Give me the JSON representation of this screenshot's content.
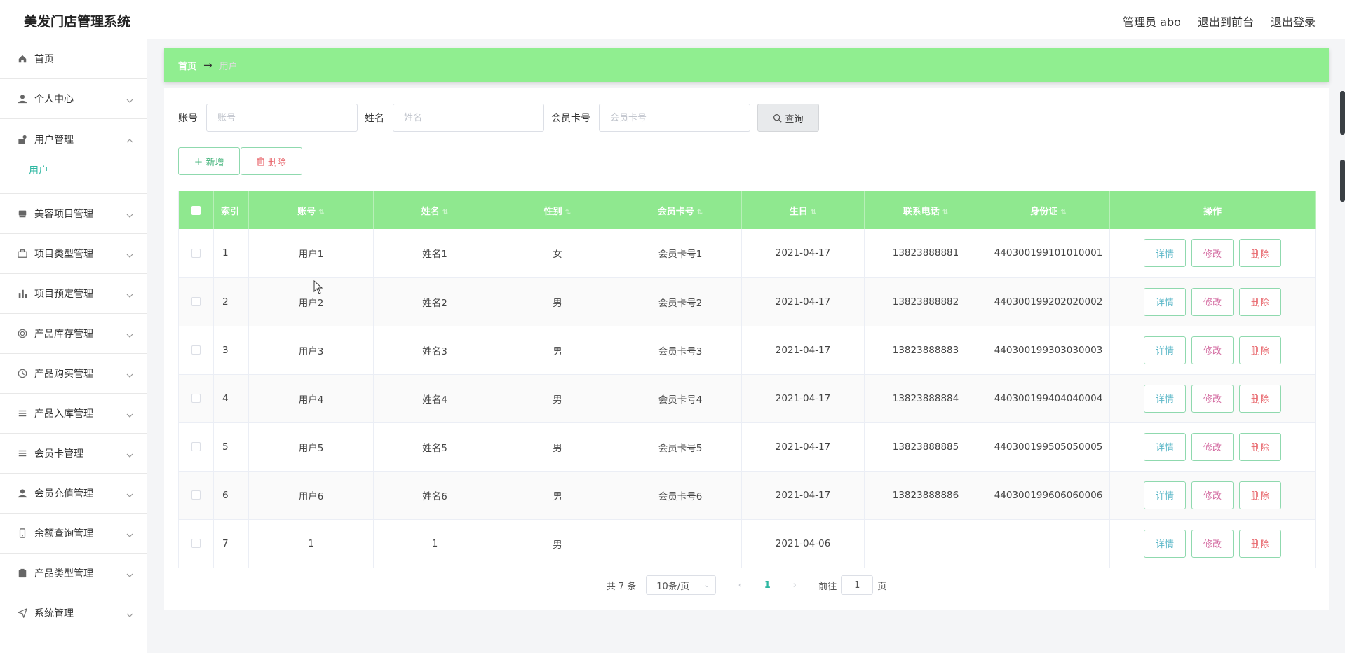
{
  "header": {
    "title": "美发门店管理系统",
    "admin": "管理员 abo",
    "to_front": "退出到前台",
    "logout": "退出登录"
  },
  "sidebar": {
    "items": [
      {
        "label": "首页",
        "icon": "home-icon"
      },
      {
        "label": "个人中心",
        "icon": "user-icon"
      },
      {
        "label": "用户管理",
        "icon": "user-manage-icon",
        "open": true,
        "children": [
          "用户"
        ]
      },
      {
        "label": "美容项目管理",
        "icon": "beauty-icon"
      },
      {
        "label": "项目类型管理",
        "icon": "briefcase-icon"
      },
      {
        "label": "项目预定管理",
        "icon": "chart-icon"
      },
      {
        "label": "产品库存管理",
        "icon": "circle-icon"
      },
      {
        "label": "产品购买管理",
        "icon": "clock-icon"
      },
      {
        "label": "产品入库管理",
        "icon": "list-icon"
      },
      {
        "label": "会员卡管理",
        "icon": "lines-icon"
      },
      {
        "label": "会员充值管理",
        "icon": "user-icon"
      },
      {
        "label": "余额查询管理",
        "icon": "phone-icon"
      },
      {
        "label": "产品类型管理",
        "icon": "clipboard-icon"
      },
      {
        "label": "系统管理",
        "icon": "send-icon"
      }
    ]
  },
  "breadcrumb": {
    "home": "首页",
    "current": "用户"
  },
  "search": {
    "account_label": "账号",
    "account_placeholder": "账号",
    "name_label": "姓名",
    "name_placeholder": "姓名",
    "card_label": "会员卡号",
    "card_placeholder": "会员卡号",
    "query_label": "查询"
  },
  "actions": {
    "add_label": "新增",
    "delete_label": "删除"
  },
  "table": {
    "headers": {
      "index": "索引",
      "account": "账号",
      "name": "姓名",
      "gender": "性别",
      "card": "会员卡号",
      "birthday": "生日",
      "phone": "联系电话",
      "id_card": "身份证",
      "ops": "操作"
    },
    "op_labels": {
      "detail": "详情",
      "edit": "修改",
      "delete": "删除"
    },
    "rows": [
      {
        "index": "1",
        "account": "用户1",
        "name": "姓名1",
        "gender": "女",
        "card": "会员卡号1",
        "birthday": "2021-04-17",
        "phone": "13823888881",
        "id_card": "440300199101010001"
      },
      {
        "index": "2",
        "account": "用户2",
        "name": "姓名2",
        "gender": "男",
        "card": "会员卡号2",
        "birthday": "2021-04-17",
        "phone": "13823888882",
        "id_card": "440300199202020002"
      },
      {
        "index": "3",
        "account": "用户3",
        "name": "姓名3",
        "gender": "男",
        "card": "会员卡号3",
        "birthday": "2021-04-17",
        "phone": "13823888883",
        "id_card": "440300199303030003"
      },
      {
        "index": "4",
        "account": "用户4",
        "name": "姓名4",
        "gender": "男",
        "card": "会员卡号4",
        "birthday": "2021-04-17",
        "phone": "13823888884",
        "id_card": "440300199404040004"
      },
      {
        "index": "5",
        "account": "用户5",
        "name": "姓名5",
        "gender": "男",
        "card": "会员卡号5",
        "birthday": "2021-04-17",
        "phone": "13823888885",
        "id_card": "440300199505050005"
      },
      {
        "index": "6",
        "account": "用户6",
        "name": "姓名6",
        "gender": "男",
        "card": "会员卡号6",
        "birthday": "2021-04-17",
        "phone": "13823888886",
        "id_card": "440300199606060006"
      },
      {
        "index": "7",
        "account": "1",
        "name": "1",
        "gender": "男",
        "card": "",
        "birthday": "2021-04-06",
        "phone": "",
        "id_card": ""
      }
    ]
  },
  "pagination": {
    "total": "共 7 条",
    "page_size": "10条/页",
    "current_page": "1",
    "goto_label": "前往",
    "goto_value": "1",
    "page_unit": "页"
  },
  "colors": {
    "accent_green": "#90ee90",
    "teal": "#2db7a1",
    "danger": "#e8676d"
  }
}
